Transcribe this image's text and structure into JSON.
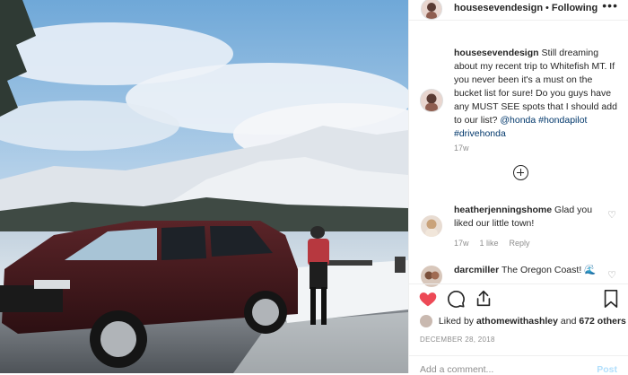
{
  "post": {
    "username": "housesevendesign",
    "separator": "•",
    "follow_status": "Following",
    "more_icon": "more-horizontal-icon"
  },
  "caption": {
    "username": "housesevendesign",
    "text": "Still dreaming about my recent trip to Whitefish MT. If you never been it's a must on the bucket list for sure! Do you guys have any MUST SEE spots that I should add to our list?",
    "tags": [
      "@honda",
      "#hondapilot",
      "#drivehonda"
    ],
    "age": "17w"
  },
  "comments": [
    {
      "username": "heatherjenningshome",
      "text": "Glad you liked our little town!",
      "age": "17w",
      "likes": "1 like",
      "reply": "Reply"
    },
    {
      "username": "darcmiller",
      "text": "The Oregon Coast!",
      "emoji": "🌊"
    }
  ],
  "likes": {
    "prefix": "Liked by",
    "user": "athomewithashley",
    "conj": "and",
    "others": "672 others"
  },
  "date": "DECEMBER 28, 2018",
  "composer": {
    "placeholder": "Add a comment...",
    "post_label": "Post"
  },
  "colors": {
    "like_red": "#ed4956",
    "link_blue": "#00376b",
    "muted": "#8e8e8e",
    "car": "#4a1a1e"
  }
}
